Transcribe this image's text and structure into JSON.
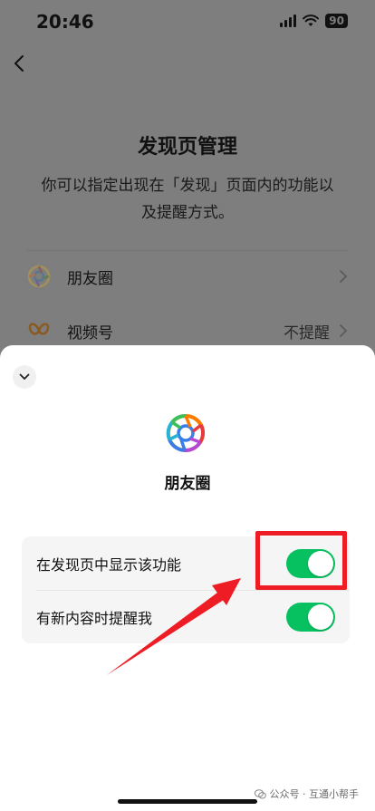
{
  "status_bar": {
    "time": "20:46",
    "battery": "90"
  },
  "background_page": {
    "title": "发现页管理",
    "description": "你可以指定出现在「发现」页面内的功能以及提醒方式。",
    "rows": [
      {
        "label": "朋友圈",
        "value": ""
      },
      {
        "label": "视频号",
        "value": "不提醒"
      }
    ]
  },
  "sheet": {
    "app_name": "朋友圈",
    "settings": [
      {
        "label": "在发现页中显示该功能",
        "enabled": true
      },
      {
        "label": "有新内容时提醒我",
        "enabled": true
      }
    ]
  },
  "watermark": {
    "text": "公众号 · 互通小帮手"
  },
  "colors": {
    "toggle_on": "#07c160",
    "highlight": "#ee1c25",
    "overlay": "#7e7e7e"
  },
  "icons": {
    "back": "chevron-left-icon",
    "collapse": "chevron-down-icon",
    "moments": "aperture-icon",
    "channels": "butterfly-icon",
    "row_chevron": "chevron-right-icon"
  }
}
